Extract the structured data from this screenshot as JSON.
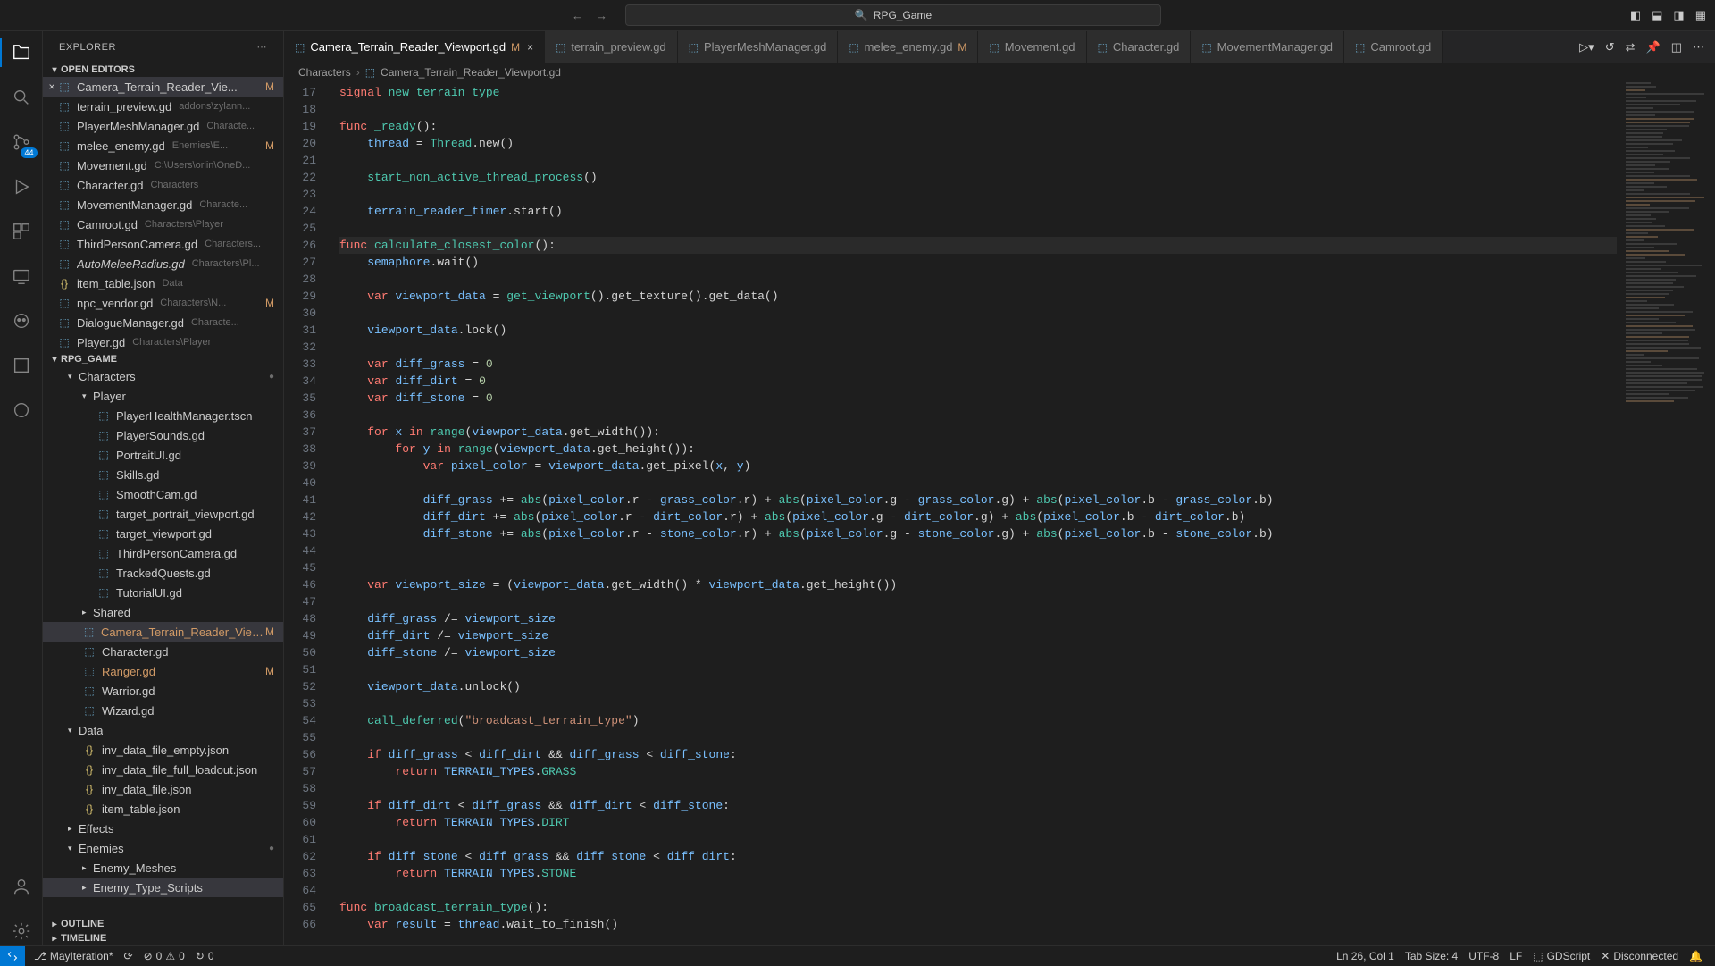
{
  "title_search": "RPG_Game",
  "activity_badge": "44",
  "explorer_title": "EXPLORER",
  "sections": {
    "open_editors": "OPEN EDITORS",
    "outline": "OUTLINE",
    "timeline": "TIMELINE"
  },
  "project_name": "RPG_GAME",
  "open_editors": [
    {
      "name": "Camera_Terrain_Reader_Vie...",
      "hint": "",
      "status": "M",
      "selected": true
    },
    {
      "name": "terrain_preview.gd",
      "hint": "addons\\zylann...",
      "status": ""
    },
    {
      "name": "PlayerMeshManager.gd",
      "hint": "Characte...",
      "status": ""
    },
    {
      "name": "melee_enemy.gd",
      "hint": "Enemies\\E...",
      "status": "M"
    },
    {
      "name": "Movement.gd",
      "hint": "C:\\Users\\orlin\\OneD...",
      "status": ""
    },
    {
      "name": "Character.gd",
      "hint": "Characters",
      "status": ""
    },
    {
      "name": "MovementManager.gd",
      "hint": "Characte...",
      "status": ""
    },
    {
      "name": "Camroot.gd",
      "hint": "Characters\\Player",
      "status": ""
    },
    {
      "name": "ThirdPersonCamera.gd",
      "hint": "Characters...",
      "status": ""
    },
    {
      "name": "AutoMeleeRadius.gd",
      "hint": "Characters\\Pl...",
      "status": "",
      "italic": true
    },
    {
      "name": "item_table.json",
      "hint": "Data",
      "status": "",
      "icon": "json"
    },
    {
      "name": "npc_vendor.gd",
      "hint": "Characters\\N...",
      "status": "M"
    },
    {
      "name": "DialogueManager.gd",
      "hint": "Characte...",
      "status": ""
    },
    {
      "name": "Player.gd",
      "hint": "Characters\\Player",
      "status": "",
      "cut": true
    }
  ],
  "tree": {
    "characters_label": "Characters",
    "player_label": "Player",
    "player_files": [
      {
        "name": "PlayerHealthManager.tscn",
        "icon": "scene"
      },
      {
        "name": "PlayerSounds.gd"
      },
      {
        "name": "PortraitUI.gd"
      },
      {
        "name": "Skills.gd"
      },
      {
        "name": "SmoothCam.gd"
      },
      {
        "name": "target_portrait_viewport.gd"
      },
      {
        "name": "target_viewport.gd"
      },
      {
        "name": "ThirdPersonCamera.gd"
      },
      {
        "name": "TrackedQuests.gd"
      },
      {
        "name": "TutorialUI.gd"
      }
    ],
    "shared_label": "Shared",
    "char_files": [
      {
        "name": "Camera_Terrain_Reader_Viewp...",
        "status": "M",
        "selected": true
      },
      {
        "name": "Character.gd"
      },
      {
        "name": "Ranger.gd",
        "status": "M"
      },
      {
        "name": "Warrior.gd"
      },
      {
        "name": "Wizard.gd"
      }
    ],
    "data_label": "Data",
    "data_files": [
      {
        "name": "inv_data_file_empty.json",
        "icon": "json"
      },
      {
        "name": "inv_data_file_full_loadout.json",
        "icon": "json"
      },
      {
        "name": "inv_data_file.json",
        "icon": "json"
      },
      {
        "name": "item_table.json",
        "icon": "json"
      }
    ],
    "effects_label": "Effects",
    "enemies_label": "Enemies",
    "enemies_sub": [
      {
        "name": "Enemy_Meshes"
      },
      {
        "name": "Enemy_Type_Scripts",
        "selected": true
      }
    ]
  },
  "tabs": [
    {
      "label": "Camera_Terrain_Reader_Viewport.gd",
      "status": "M",
      "close": true,
      "active": true
    },
    {
      "label": "terrain_preview.gd"
    },
    {
      "label": "PlayerMeshManager.gd"
    },
    {
      "label": "melee_enemy.gd",
      "status": "M"
    },
    {
      "label": "Movement.gd"
    },
    {
      "label": "Character.gd"
    },
    {
      "label": "MovementManager.gd"
    },
    {
      "label": "Camroot.gd"
    }
  ],
  "breadcrumb": [
    "Characters",
    "Camera_Terrain_Reader_Viewport.gd"
  ],
  "line_start": 17,
  "code_lines": [
    "<span class='kw'>signal</span> <span class='fn'>new_terrain_type</span>",
    "",
    "<span class='kw'>func</span> <span class='fn'>_ready</span>():",
    "\t<span class='var'>thread</span> = <span class='fn'>Thread</span>.new()",
    "",
    "\t<span class='fn'>start_non_active_thread_process</span>()",
    "",
    "\t<span class='var'>terrain_reader_timer</span>.start()",
    "",
    "<span class='kw'>func</span> <span class='fn'>calculate_closest_color</span>():",
    "\t<span class='var'>semaphore</span>.wait()",
    "",
    "\t<span class='kw'>var</span> <span class='var'>viewport_data</span> = <span class='fn'>get_viewport</span>().get_texture().get_data()",
    "",
    "\t<span class='var'>viewport_data</span>.lock()",
    "",
    "\t<span class='kw'>var</span> <span class='var'>diff_grass</span> = <span class='num'>0</span>",
    "\t<span class='kw'>var</span> <span class='var'>diff_dirt</span> = <span class='num'>0</span>",
    "\t<span class='kw'>var</span> <span class='var'>diff_stone</span> = <span class='num'>0</span>",
    "",
    "\t<span class='kw'>for</span> <span class='var'>x</span> <span class='kw'>in</span> <span class='fn'>range</span>(<span class='var'>viewport_data</span>.get_width()):",
    "\t\t<span class='kw'>for</span> <span class='var'>y</span> <span class='kw'>in</span> <span class='fn'>range</span>(<span class='var'>viewport_data</span>.get_height()):",
    "\t\t\t<span class='kw'>var</span> <span class='var'>pixel_color</span> = <span class='var'>viewport_data</span>.get_pixel(<span class='var'>x</span>, <span class='var'>y</span>)",
    "",
    "\t\t\t<span class='var'>diff_grass</span> += <span class='fn'>abs</span>(<span class='var'>pixel_color</span>.r - <span class='var'>grass_color</span>.r) + <span class='fn'>abs</span>(<span class='var'>pixel_color</span>.g - <span class='var'>grass_color</span>.g) + <span class='fn'>abs</span>(<span class='var'>pixel_color</span>.b - <span class='var'>grass_color</span>.b)",
    "\t\t\t<span class='var'>diff_dirt</span> += <span class='fn'>abs</span>(<span class='var'>pixel_color</span>.r - <span class='var'>dirt_color</span>.r) + <span class='fn'>abs</span>(<span class='var'>pixel_color</span>.g - <span class='var'>dirt_color</span>.g) + <span class='fn'>abs</span>(<span class='var'>pixel_color</span>.b - <span class='var'>dirt_color</span>.b)",
    "\t\t\t<span class='var'>diff_stone</span> += <span class='fn'>abs</span>(<span class='var'>pixel_color</span>.r - <span class='var'>stone_color</span>.r) + <span class='fn'>abs</span>(<span class='var'>pixel_color</span>.g - <span class='var'>stone_color</span>.g) + <span class='fn'>abs</span>(<span class='var'>pixel_color</span>.b - <span class='var'>stone_color</span>.b)",
    "",
    "",
    "\t<span class='kw'>var</span> <span class='var'>viewport_size</span> = (<span class='var'>viewport_data</span>.get_width() * <span class='var'>viewport_data</span>.get_height())",
    "",
    "\t<span class='var'>diff_grass</span> /= <span class='var'>viewport_size</span>",
    "\t<span class='var'>diff_dirt</span> /= <span class='var'>viewport_size</span>",
    "\t<span class='var'>diff_stone</span> /= <span class='var'>viewport_size</span>",
    "",
    "\t<span class='var'>viewport_data</span>.unlock()",
    "",
    "\t<span class='fn'>call_deferred</span>(<span class='str'>\"broadcast_terrain_type\"</span>)",
    "",
    "\t<span class='kw'>if</span> <span class='var'>diff_grass</span> &lt; <span class='var'>diff_dirt</span> &amp;&amp; <span class='var'>diff_grass</span> &lt; <span class='var'>diff_stone</span>:",
    "\t\t<span class='kw'>return</span> <span class='var'>TERRAIN_TYPES</span>.<span class='const'>GRASS</span>",
    "",
    "\t<span class='kw'>if</span> <span class='var'>diff_dirt</span> &lt; <span class='var'>diff_grass</span> &amp;&amp; <span class='var'>diff_dirt</span> &lt; <span class='var'>diff_stone</span>:",
    "\t\t<span class='kw'>return</span> <span class='var'>TERRAIN_TYPES</span>.<span class='const'>DIRT</span>",
    "",
    "\t<span class='kw'>if</span> <span class='var'>diff_stone</span> &lt; <span class='var'>diff_grass</span> &amp;&amp; <span class='var'>diff_stone</span> &lt; <span class='var'>diff_dirt</span>:",
    "\t\t<span class='kw'>return</span> <span class='var'>TERRAIN_TYPES</span>.<span class='const'>STONE</span>",
    "",
    "<span class='kw'>func</span> <span class='fn'>broadcast_terrain_type</span>():",
    "\t<span class='kw'>var</span> <span class='var'>result</span> = <span class='var'>thread</span>.wait_to_finish()"
  ],
  "highlight_index": 9,
  "status": {
    "branch": "MayIteration*",
    "sync": "⟳",
    "errors": "0",
    "warnings": "0",
    "ports": "0",
    "lncol": "Ln 26, Col 1",
    "tabsize": "Tab Size: 4",
    "encoding": "UTF-8",
    "eol": "LF",
    "lang": "GDScript",
    "conn": "Disconnected"
  }
}
